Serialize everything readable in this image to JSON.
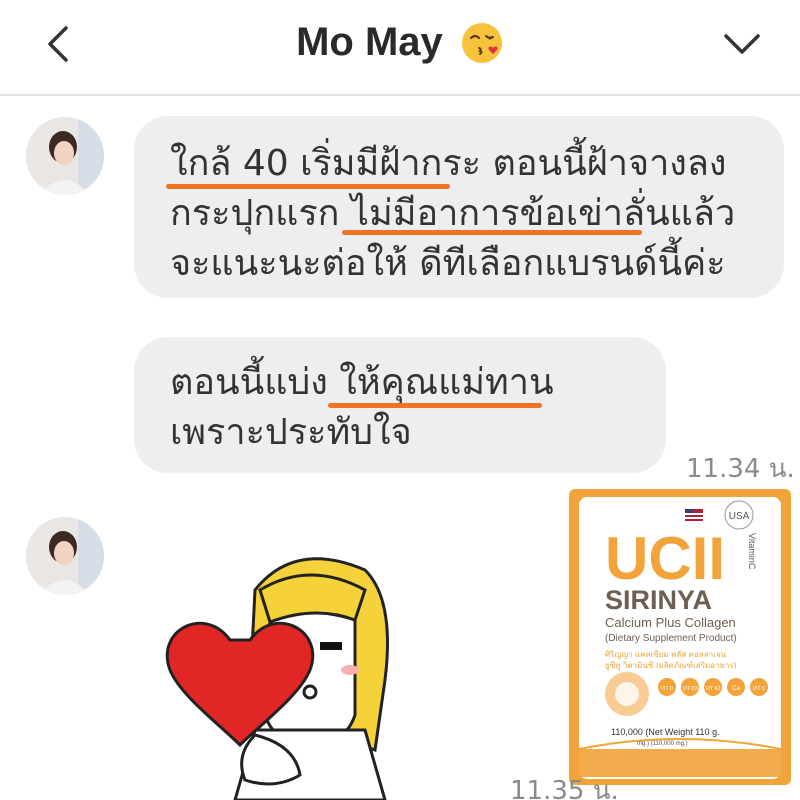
{
  "header": {
    "title": "Mo May",
    "back_icon": "chevron-left-icon",
    "emoji_icon": "kissing-face-icon",
    "menu_icon": "chevron-down-icon"
  },
  "messages": [
    {
      "lines": [
        "ใกล้ 40 เริ่มมีฝ้ากระ ตอนนี้ฝ้าจางลง",
        "กระปุกแรก ไม่มีอาการข้อเข่าลั่นแล้ว",
        "จะแนะนะต่อให้ ดีทีเลือกแบรนด์นี้ค่ะ"
      ]
    },
    {
      "lines": [
        "ตอนนี้แบ่ง ให้คุณแม่ทาน",
        "เพราะประทับใจ"
      ],
      "time": "11.34 น."
    }
  ],
  "attachment": {
    "brand_top": "USA",
    "logo": "UCII",
    "side_text": "VitaminC",
    "name": "SIRINYA",
    "subtitle": "Calcium Plus Collagen",
    "note": "(Dietary Supplement Product)",
    "thai_line1": "ศิริญญา แคลเซียม พลัส คอลลาเจน",
    "thai_line2": "ยูซีทู วิตามินซี (ผลิตภัณฑ์เสริมอาหาร)",
    "badges": [
      "VIT D",
      "VIT D3",
      "VIT K2",
      "Ca",
      "VIT C"
    ],
    "weight_main": "110,000 (Net Weight 110 g.",
    "weight_sub": "mg.) (110,000 mg.)",
    "time": "11.35 น."
  },
  "colors": {
    "highlight": "#f07422",
    "bubble": "#eeeef0",
    "product_accent": "#f2a33a"
  }
}
